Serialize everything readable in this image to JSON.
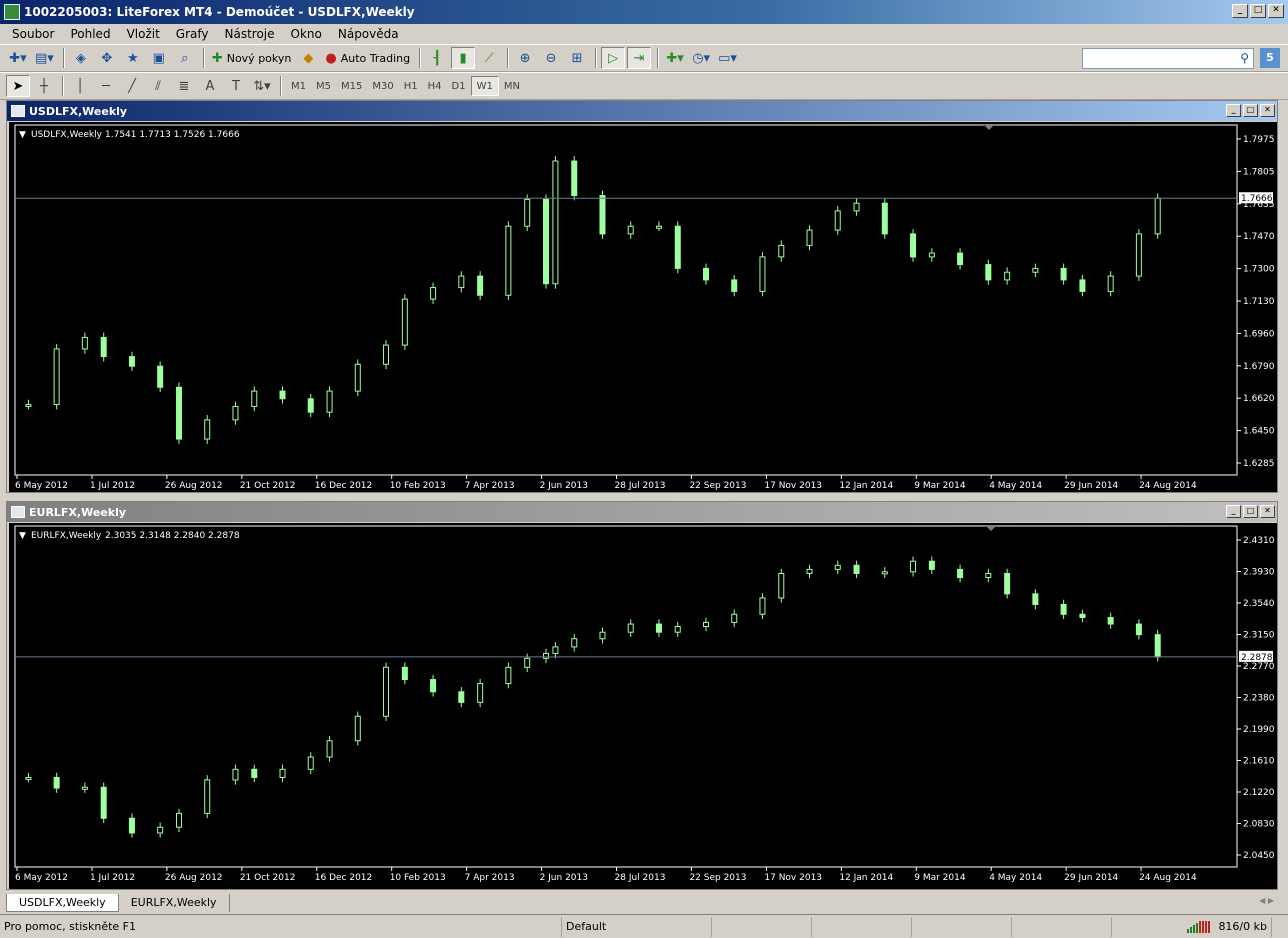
{
  "window": {
    "title": "1002205003: LiteForex MT4 - Demoúčet - USDLFX,Weekly"
  },
  "menu": [
    "Soubor",
    "Pohled",
    "Vložit",
    "Grafy",
    "Nástroje",
    "Okno",
    "Nápověda"
  ],
  "toolbar": {
    "new_order_label": "Nový pokyn",
    "auto_trading_label": "Auto Trading",
    "search_placeholder": "",
    "badge": "5"
  },
  "timeframes": [
    "M1",
    "M5",
    "M15",
    "M30",
    "H1",
    "H4",
    "D1",
    "W1",
    "MN"
  ],
  "active_timeframe": "W1",
  "charts": [
    {
      "window_title": "USDLFX,Weekly",
      "info_symbol": "USDLFX,Weekly",
      "info_ohlc": "1.7541 1.7713 1.7526 1.7666",
      "price_labels": [
        "1.7975",
        "1.7805",
        "1.7635",
        "1.7470",
        "1.7300",
        "1.7130",
        "1.6960",
        "1.6790",
        "1.6620",
        "1.6450",
        "1.6285"
      ],
      "current_price": "1.7666",
      "date_labels": [
        "6 May 2012",
        "1 Jul 2012",
        "26 Aug 2012",
        "21 Oct 2012",
        "16 Dec 2012",
        "10 Feb 2013",
        "7 Apr 2013",
        "2 Jun 2013",
        "28 Jul 2013",
        "22 Sep 2013",
        "17 Nov 2013",
        "12 Jan 2014",
        "9 Mar 2014",
        "4 May 2014",
        "29 Jun 2014",
        "24 Aug 2014"
      ]
    },
    {
      "window_title": "EURLFX,Weekly",
      "info_symbol": "EURLFX,Weekly",
      "info_ohlc": "2.3035 2.3148 2.2840 2.2878",
      "price_labels": [
        "2.4310",
        "2.3930",
        "2.3540",
        "2.3150",
        "2.2770",
        "2.2380",
        "2.1990",
        "2.1610",
        "2.1220",
        "2.0830",
        "2.0450"
      ],
      "current_price": "2.2878",
      "date_labels": [
        "6 May 2012",
        "1 Jul 2012",
        "26 Aug 2012",
        "21 Oct 2012",
        "16 Dec 2012",
        "10 Feb 2013",
        "7 Apr 2013",
        "2 Jun 2013",
        "28 Jul 2013",
        "22 Sep 2013",
        "17 Nov 2013",
        "12 Jan 2014",
        "9 Mar 2014",
        "4 May 2014",
        "29 Jun 2014",
        "24 Aug 2014"
      ]
    }
  ],
  "tabs": [
    "USDLFX,Weekly",
    "EURLFX,Weekly"
  ],
  "active_tab": "USDLFX,Weekly",
  "status": {
    "help": "Pro pomoc, stiskněte F1",
    "profile": "Default",
    "traffic": "816/0 kb"
  },
  "colors": {
    "chart_bg": "#000000",
    "candle": "#9dff9d",
    "axis": "#ffffff",
    "price_line": "#6c7b94"
  },
  "chart_data": [
    {
      "type": "candlestick",
      "title": "USDLFX,Weekly",
      "ylim": [
        1.6285,
        1.7975
      ],
      "close_points": [
        [
          "2012-05-06",
          1.659
        ],
        [
          "2012-05-27",
          1.688
        ],
        [
          "2012-06-17",
          1.694
        ],
        [
          "2012-07-01",
          1.684
        ],
        [
          "2012-07-22",
          1.679
        ],
        [
          "2012-08-12",
          1.668
        ],
        [
          "2012-08-26",
          1.641
        ],
        [
          "2012-09-16",
          1.651
        ],
        [
          "2012-10-07",
          1.658
        ],
        [
          "2012-10-21",
          1.666
        ],
        [
          "2012-11-11",
          1.662
        ],
        [
          "2012-12-02",
          1.655
        ],
        [
          "2012-12-16",
          1.666
        ],
        [
          "2013-01-06",
          1.68
        ],
        [
          "2013-01-27",
          1.69
        ],
        [
          "2013-02-10",
          1.714
        ],
        [
          "2013-03-03",
          1.72
        ],
        [
          "2013-03-24",
          1.726
        ],
        [
          "2013-04-07",
          1.716
        ],
        [
          "2013-04-28",
          1.752
        ],
        [
          "2013-05-12",
          1.766
        ],
        [
          "2013-05-26",
          1.722
        ],
        [
          "2013-06-02",
          1.786
        ],
        [
          "2013-06-16",
          1.768
        ],
        [
          "2013-07-07",
          1.748
        ],
        [
          "2013-07-28",
          1.752
        ],
        [
          "2013-08-18",
          1.752
        ],
        [
          "2013-09-01",
          1.73
        ],
        [
          "2013-09-22",
          1.724
        ],
        [
          "2013-10-13",
          1.718
        ],
        [
          "2013-11-03",
          1.736
        ],
        [
          "2013-11-17",
          1.742
        ],
        [
          "2013-12-08",
          1.75
        ],
        [
          "2013-12-29",
          1.76
        ],
        [
          "2014-01-12",
          1.764
        ],
        [
          "2014-02-02",
          1.748
        ],
        [
          "2014-02-23",
          1.736
        ],
        [
          "2014-03-09",
          1.738
        ],
        [
          "2014-03-30",
          1.732
        ],
        [
          "2014-04-20",
          1.724
        ],
        [
          "2014-05-04",
          1.728
        ],
        [
          "2014-05-25",
          1.73
        ],
        [
          "2014-06-15",
          1.724
        ],
        [
          "2014-06-29",
          1.718
        ],
        [
          "2014-07-20",
          1.726
        ],
        [
          "2014-08-10",
          1.748
        ],
        [
          "2014-08-24",
          1.7666
        ]
      ]
    },
    {
      "type": "candlestick",
      "title": "EURLFX,Weekly",
      "ylim": [
        2.045,
        2.431
      ],
      "close_points": [
        [
          "2012-05-06",
          2.14
        ],
        [
          "2012-05-27",
          2.127
        ],
        [
          "2012-06-17",
          2.128
        ],
        [
          "2012-07-01",
          2.09
        ],
        [
          "2012-07-22",
          2.072
        ],
        [
          "2012-08-12",
          2.079
        ],
        [
          "2012-08-26",
          2.096
        ],
        [
          "2012-09-16",
          2.137
        ],
        [
          "2012-10-07",
          2.15
        ],
        [
          "2012-10-21",
          2.14
        ],
        [
          "2012-11-11",
          2.15
        ],
        [
          "2012-12-02",
          2.165
        ],
        [
          "2012-12-16",
          2.185
        ],
        [
          "2013-01-06",
          2.215
        ],
        [
          "2013-01-27",
          2.275
        ],
        [
          "2013-02-10",
          2.26
        ],
        [
          "2013-03-03",
          2.245
        ],
        [
          "2013-03-24",
          2.232
        ],
        [
          "2013-04-07",
          2.255
        ],
        [
          "2013-04-28",
          2.275
        ],
        [
          "2013-05-12",
          2.286
        ],
        [
          "2013-05-26",
          2.292
        ],
        [
          "2013-06-02",
          2.3
        ],
        [
          "2013-06-16",
          2.31
        ],
        [
          "2013-07-07",
          2.318
        ],
        [
          "2013-07-28",
          2.328
        ],
        [
          "2013-08-18",
          2.318
        ],
        [
          "2013-09-01",
          2.325
        ],
        [
          "2013-09-22",
          2.33
        ],
        [
          "2013-10-13",
          2.34
        ],
        [
          "2013-11-03",
          2.36
        ],
        [
          "2013-11-17",
          2.39
        ],
        [
          "2013-12-08",
          2.395
        ],
        [
          "2013-12-29",
          2.4
        ],
        [
          "2014-01-12",
          2.39
        ],
        [
          "2014-02-02",
          2.392
        ],
        [
          "2014-02-23",
          2.405
        ],
        [
          "2014-03-09",
          2.395
        ],
        [
          "2014-03-30",
          2.385
        ],
        [
          "2014-04-20",
          2.39
        ],
        [
          "2014-05-04",
          2.365
        ],
        [
          "2014-05-25",
          2.352
        ],
        [
          "2014-06-15",
          2.34
        ],
        [
          "2014-06-29",
          2.336
        ],
        [
          "2014-07-20",
          2.328
        ],
        [
          "2014-08-10",
          2.315
        ],
        [
          "2014-08-24",
          2.2878
        ]
      ]
    }
  ]
}
